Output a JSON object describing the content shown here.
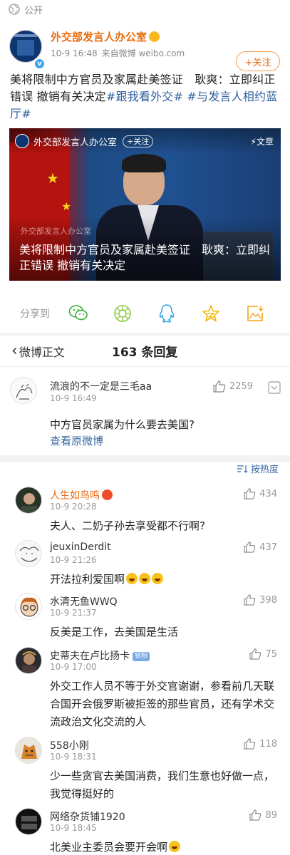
{
  "topbar": {
    "visibility": "公开",
    "icon": "globe-icon"
  },
  "post": {
    "author": "外交部发言人办公室",
    "time": "10-9 16:48",
    "source": "来自微博 weibo.com",
    "follow_label": "+关注",
    "text_plain": "美将限制中方官员及家属赴美签证　耿爽：立即纠正错误 撤销有关决定",
    "tag1": "#跟我看外交#",
    "tag2": "#与发言人相约蓝厅#"
  },
  "card": {
    "author": "外交部发言人办公室",
    "follow_label": "+关注",
    "article_label": "文章",
    "watermark": "外交部发言人办公室",
    "title": "美将限制中方官员及家属赴美签证　耿爽：立即纠正错误 撤销有关决定"
  },
  "share": {
    "label": "分享到",
    "icons": [
      "wechat-icon",
      "moments-icon",
      "qq-icon",
      "qzone-icon",
      "save-image-icon"
    ]
  },
  "reply_header": {
    "back_label": "微博正文",
    "count_label": "163 条回复"
  },
  "original_comment": {
    "name": "流浪的不一定是三毛aa",
    "time": "10-9 16:49",
    "likes": "2259",
    "text": "中方官员家属为什么要去美国?",
    "view_original": "查看原微博"
  },
  "sort_label": "按热度",
  "comments": [
    {
      "name": "人生如鸟鸣",
      "time": "10-9 20:28",
      "likes": "434",
      "text": "夫人、二奶子孙去享受都不行啊?"
    },
    {
      "name": "jeuxinDerdit",
      "time": "10-9 21:26",
      "likes": "437",
      "text": "开法拉利爱国啊"
    },
    {
      "name": "水清无鱼WWQ",
      "time": "10-9 21:37",
      "likes": "398",
      "text": "反美是工作，去美国是生活"
    },
    {
      "name": "史蒂夫在卢比扬卡",
      "badge": "铁粉",
      "time": "10-9 17:00",
      "likes": "75",
      "text": "外交工作人员不等于外交官谢谢，参看前几天联合国开会俄罗斯被拒签的那些官员，还有学术交流政治文化交流的人"
    },
    {
      "name": "558小刚",
      "time": "10-9 18:31",
      "likes": "118",
      "text": "少一些贪官去美国消费，我们生意也好做一点，我觉得挺好的"
    },
    {
      "name": "网络杂货铺1920",
      "time": "10-9 18:45",
      "likes": "89",
      "text": "北美业主委员会要开会啊"
    }
  ]
}
